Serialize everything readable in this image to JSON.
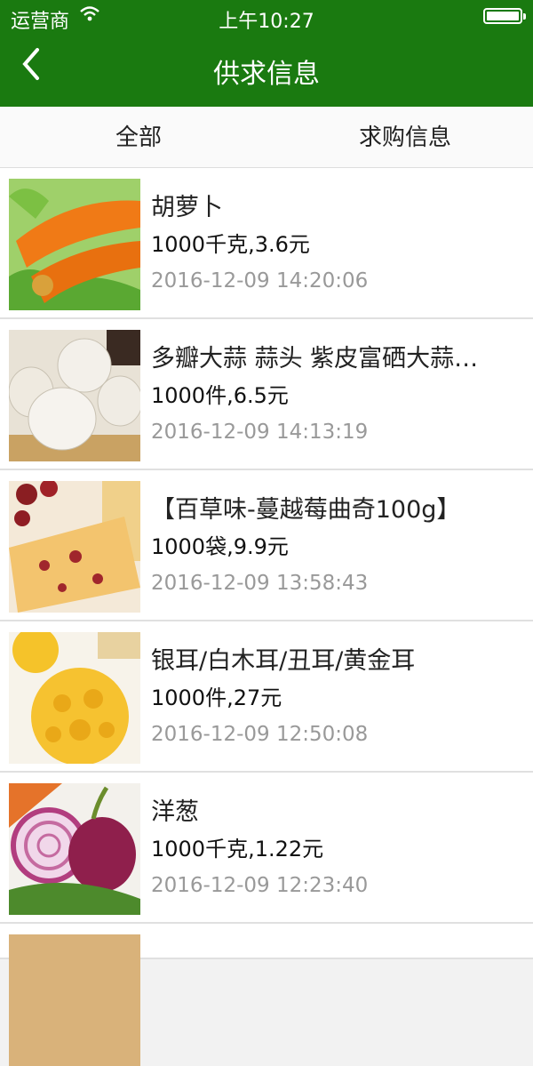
{
  "status": {
    "carrier": "运营商",
    "time": "上午10:27"
  },
  "nav": {
    "title": "供求信息"
  },
  "tabs": [
    {
      "label": "全部"
    },
    {
      "label": "求购信息"
    }
  ],
  "items": [
    {
      "name": "胡萝卜",
      "price": "1000千克,3.6元",
      "date": "2016-12-09 14:20:06"
    },
    {
      "name": "多瓣大蒜 蒜头 紫皮富硒大蒜…",
      "price": "1000件,6.5元",
      "date": "2016-12-09 14:13:19"
    },
    {
      "name": "【百草味-蔓越莓曲奇100g】",
      "price": "1000袋,9.9元",
      "date": "2016-12-09 13:58:43"
    },
    {
      "name": "银耳/白木耳/丑耳/黄金耳",
      "price": "1000件,27元",
      "date": "2016-12-09 12:50:08"
    },
    {
      "name": "洋葱",
      "price": "1000千克,1.22元",
      "date": "2016-12-09 12:23:40"
    }
  ]
}
